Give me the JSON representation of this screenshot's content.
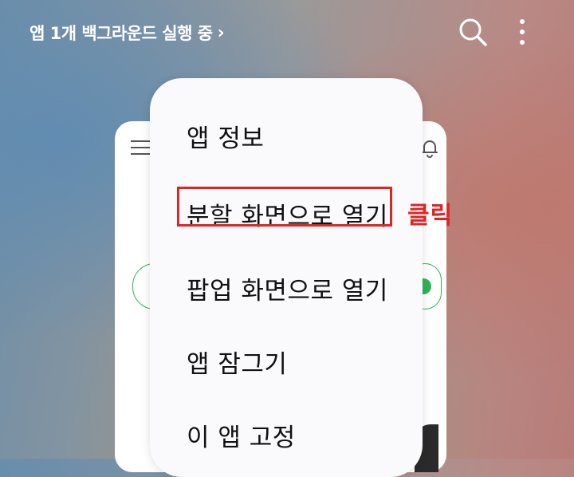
{
  "status_bar": {
    "background_apps_text": "앱 1개 백그라운드 실행 중",
    "chevron_glyph": "›"
  },
  "icons": {
    "search": "search-icon",
    "more": "more-vertical-icon",
    "menu": "hamburger-menu-icon",
    "notification": "bell-icon"
  },
  "context_menu": {
    "items": [
      {
        "label": "앱 정보"
      },
      {
        "label": "분할 화면으로 열기"
      },
      {
        "label": "팝업 화면으로 열기"
      },
      {
        "label": "앱 잠그기"
      },
      {
        "label": "이 앱 고정"
      }
    ]
  },
  "annotation": {
    "click_label": "클릭",
    "color": "#e02424"
  },
  "colors": {
    "accent_green": "#2fb35a",
    "menu_background": "#fafafc"
  }
}
